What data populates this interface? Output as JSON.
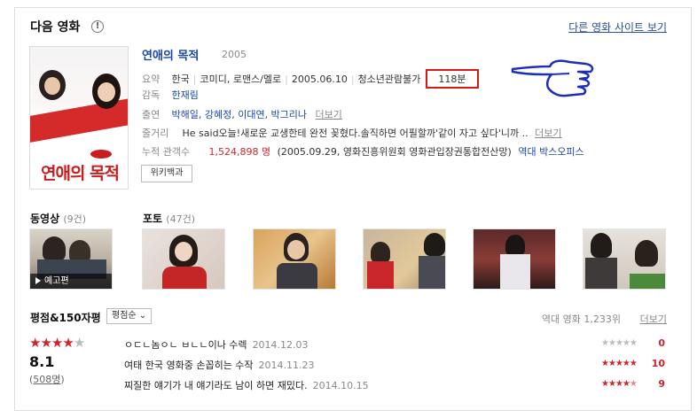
{
  "header": {
    "title": "다음 영화",
    "info_glyph": "!",
    "other_sites_link": "다른 영화 사이트 보기"
  },
  "poster": {
    "title_text": "연애의 목적"
  },
  "movie": {
    "title": "연애의 목적",
    "year": "2005",
    "summary_label": "요약",
    "country": "한국",
    "genre": "코미디, 로맨스/멜로",
    "release_date": "2005.06.10",
    "rating": "청소년관람불가",
    "runtime": "118분",
    "director_label": "감독",
    "director": "한재림",
    "cast_label": "출연",
    "cast": "박해일, 강혜정, 이대연, 박그리나",
    "cast_more": "더보기",
    "plot_label": "줄거리",
    "plot": "He said오늘!새로운 교생한테 완전 꽂혔다.솔직하면 어필할까'같이 자고 싶다'니까 ..",
    "plot_more": "더보기",
    "audience_label": "누적 관객수",
    "audience_count": "1,524,898 명",
    "audience_note": "(2005.09.29, 영화진흥위원회 영화관입장권통합전산망)",
    "boxoffice_link": "역대 박스오피스",
    "wiki_button": "위키백과"
  },
  "media": {
    "video_label": "동영상",
    "video_count": "(9건)",
    "video_caption": "예고편",
    "photo_label": "포토",
    "photo_count": "(47건)"
  },
  "reviews": {
    "title": "평점&150자평",
    "sort_label": "평점순",
    "rank_text": "역대 영화 1,233위",
    "more": "더보기",
    "avg_score": "8.1",
    "avg_stars": 4,
    "count_prefix": "(",
    "count": "508명",
    "count_suffix": ")",
    "items": [
      {
        "text": "ㅇㄷㄴ놈ㅇㄴ ㅂㄴㄴ이나 수렉",
        "date": "2014.12.03",
        "stars": 0,
        "score": "0"
      },
      {
        "text": "여태 한국 영화중 손꼽히는 수작",
        "date": "2014.11.23",
        "stars": 5,
        "score": "10"
      },
      {
        "text": "찌질한 얘기가 내 얘기라도 남이 하면 재밌다.",
        "date": "2014.10.15",
        "stars": 4.5,
        "score": "9"
      }
    ]
  },
  "colors": {
    "link": "#1a46a8",
    "accent_red": "#d1252b",
    "highlight_box": "#d61a1a",
    "hand": "#1b2fb8"
  }
}
